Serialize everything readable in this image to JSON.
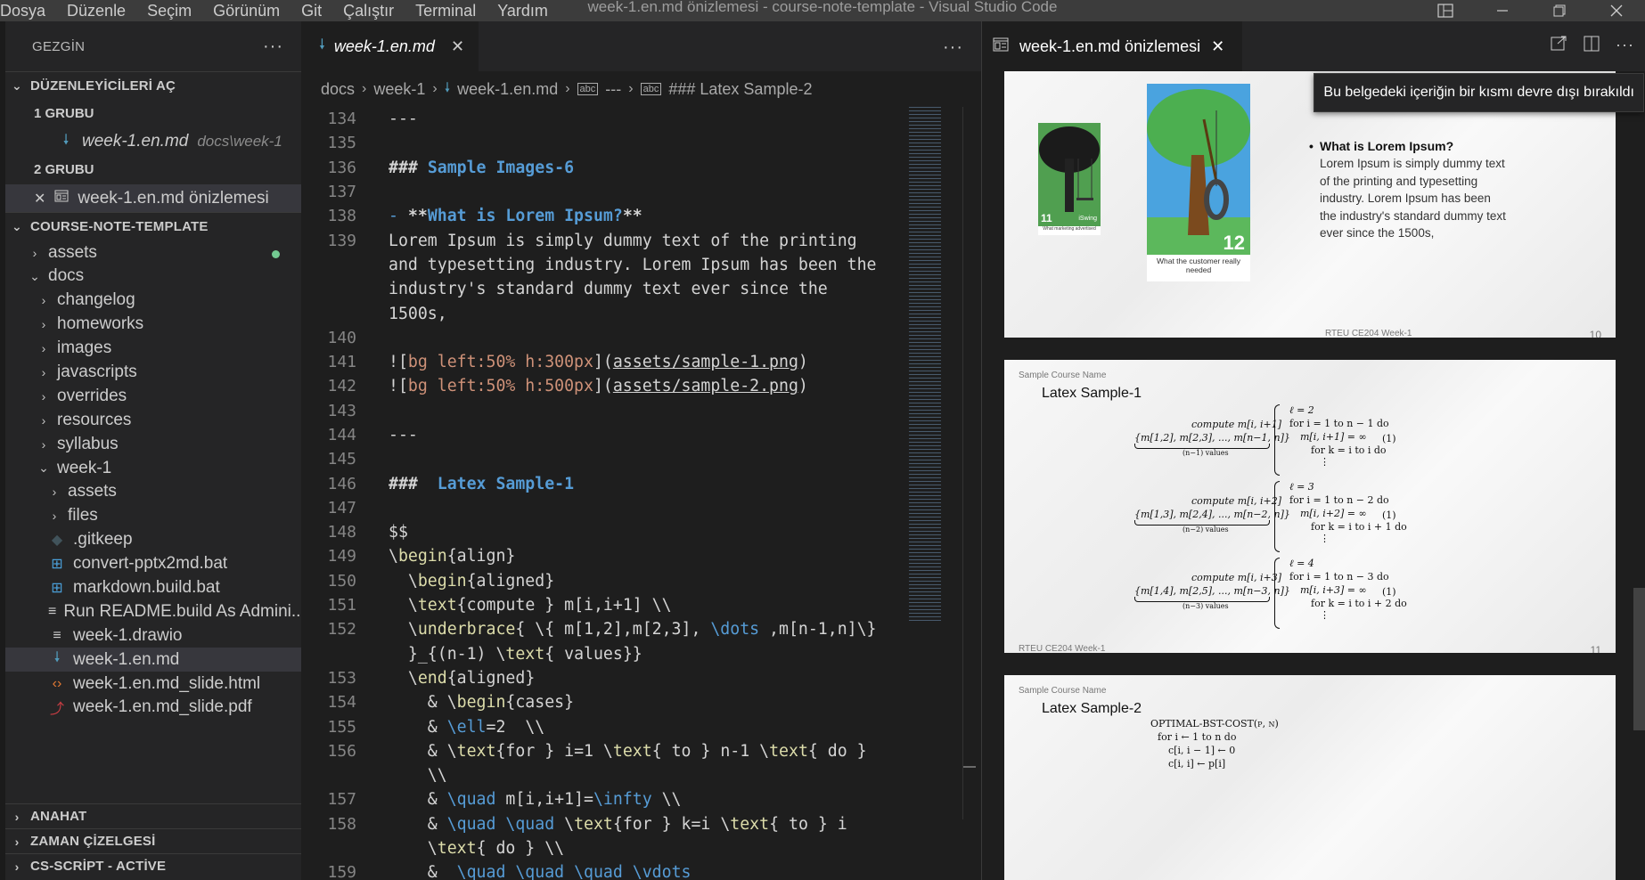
{
  "titlebar": {
    "menus": [
      "Dosya",
      "Düzenle",
      "Seçim",
      "Görünüm",
      "Git",
      "Çalıştır",
      "Terminal",
      "Yardım"
    ],
    "title": "week-1.en.md önizlemesi - course-note-template - Visual Studio Code"
  },
  "sidebar": {
    "title": "GEZGİN",
    "open_editors": {
      "label": "DÜZENLEYİCİLERİ AÇ",
      "group1": "1 GRUBU",
      "group1_file": "week-1.en.md",
      "group1_desc": "docs\\week-1",
      "group2": "2 GRUBU",
      "group2_file": "week-1.en.md önizlemesi"
    },
    "project": "COURSE-NOTE-TEMPLATE",
    "tree": [
      {
        "label": "assets",
        "indent": 1,
        "type": "folder",
        "open": false
      },
      {
        "label": "docs",
        "indent": 1,
        "type": "folder",
        "open": true
      },
      {
        "label": "changelog",
        "indent": 2,
        "type": "folder",
        "open": false
      },
      {
        "label": "homeworks",
        "indent": 2,
        "type": "folder",
        "open": false
      },
      {
        "label": "images",
        "indent": 2,
        "type": "folder",
        "open": false
      },
      {
        "label": "javascripts",
        "indent": 2,
        "type": "folder",
        "open": false
      },
      {
        "label": "overrides",
        "indent": 2,
        "type": "folder",
        "open": false
      },
      {
        "label": "resources",
        "indent": 2,
        "type": "folder",
        "open": false
      },
      {
        "label": "syllabus",
        "indent": 2,
        "type": "folder",
        "open": false
      },
      {
        "label": "week-1",
        "indent": 2,
        "type": "folder",
        "open": true
      },
      {
        "label": "assets",
        "indent": 3,
        "type": "folder",
        "open": false
      },
      {
        "label": "files",
        "indent": 3,
        "type": "folder",
        "open": false
      },
      {
        "label": ".gitkeep",
        "indent": 3,
        "type": "file",
        "icon": "git"
      },
      {
        "label": "convert-pptx2md.bat",
        "indent": 3,
        "type": "file",
        "icon": "win"
      },
      {
        "label": "markdown.build.bat",
        "indent": 3,
        "type": "file",
        "icon": "win"
      },
      {
        "label": "Run README.build As Admini...",
        "indent": 3,
        "type": "file",
        "icon": "lines"
      },
      {
        "label": "week-1.drawio",
        "indent": 3,
        "type": "file",
        "icon": "lines"
      },
      {
        "label": "week-1.en.md",
        "indent": 3,
        "type": "file",
        "icon": "md"
      },
      {
        "label": "week-1.en.md_slide.html",
        "indent": 3,
        "type": "file",
        "icon": "html"
      },
      {
        "label": "week-1.en.md_slide.pdf",
        "indent": 3,
        "type": "file",
        "icon": "pdf"
      }
    ],
    "outline": "ANAHAT",
    "timeline": "ZAMAN ÇİZELGESİ",
    "cs_script": "CS-SCRİPT - ACTİVE"
  },
  "editor": {
    "tab_label": "week-1.en.md",
    "breadcrumb": [
      "docs",
      "week-1",
      "week-1.en.md",
      "---",
      "### Latex Sample-2"
    ],
    "lines": [
      {
        "n": "134",
        "t": "---"
      },
      {
        "n": "135",
        "t": ""
      },
      {
        "n": "136",
        "t": "### Sample Images-6"
      },
      {
        "n": "137",
        "t": ""
      },
      {
        "n": "138",
        "t": "- **What is Lorem Ipsum?**"
      },
      {
        "n": "139",
        "t": "Lorem Ipsum is simply dummy text of the printing"
      },
      {
        "n": "",
        "t": "and typesetting industry. Lorem Ipsum has been the"
      },
      {
        "n": "",
        "t": "industry's standard dummy text ever since the"
      },
      {
        "n": "",
        "t": "1500s,"
      },
      {
        "n": "140",
        "t": ""
      },
      {
        "n": "141",
        "t": "![bg left:50% h:300px](assets/sample-1.png)"
      },
      {
        "n": "142",
        "t": "![bg left:50% h:500px](assets/sample-2.png)"
      },
      {
        "n": "143",
        "t": ""
      },
      {
        "n": "144",
        "t": "---"
      },
      {
        "n": "145",
        "t": ""
      },
      {
        "n": "146",
        "t": "###  Latex Sample-1"
      },
      {
        "n": "147",
        "t": ""
      },
      {
        "n": "148",
        "t": "$$"
      },
      {
        "n": "149",
        "t": "\\begin{align}"
      },
      {
        "n": "150",
        "t": "  \\begin{aligned}"
      },
      {
        "n": "151",
        "t": "  \\text{compute } m[i,i+1] \\\\"
      },
      {
        "n": "152",
        "t": "  \\underbrace{ \\{ m[1,2],m[2,3], \\dots ,m[n-1,n]\\}"
      },
      {
        "n": "",
        "t": "  }_{(n-1) \\text{ values}}"
      },
      {
        "n": "153",
        "t": "  \\end{aligned}"
      },
      {
        "n": "154",
        "t": "    & \\begin{cases}"
      },
      {
        "n": "155",
        "t": "    & \\ell=2  \\\\"
      },
      {
        "n": "156",
        "t": "    & \\text{for } i=1 \\text{ to } n-1 \\text{ do }"
      },
      {
        "n": "",
        "t": "    \\\\"
      },
      {
        "n": "157",
        "t": "    & \\quad m[i,i+1]=\\infty \\\\"
      },
      {
        "n": "158",
        "t": "    & \\quad \\quad \\text{for } k=i \\text{ to } i"
      },
      {
        "n": "",
        "t": "    \\text{ do } \\\\"
      },
      {
        "n": "159",
        "t": "    &  \\quad \\quad \\quad \\vdots"
      }
    ]
  },
  "preview": {
    "tab_label": "week-1.en.md önizlemesi",
    "banner": "Bu belgedeki içeriğin bir kısmı devre dışı bırakıldı",
    "slide10": {
      "img1_num": "11",
      "img1_tag": "iSwing",
      "img1_caption": "What marketing advertised",
      "img2_num": "12",
      "img2_caption": "What the customer really needed",
      "bullet_title": "What is Lorem Ipsum?",
      "bullet_text": "Lorem Ipsum is simply dummy text of the printing and typesetting industry. Lorem Ipsum has been the industry's standard dummy text ever since the 1500s,",
      "footer": "RTEU CE204 Week-1",
      "page": "10"
    },
    "slide11": {
      "course": "Sample Course Name",
      "title": "Latex Sample-1",
      "blocks": [
        {
          "compute": "compute m[i, i+1]",
          "set": "{m[1,2], m[2,3], ..., m[n−1, n]}",
          "values": "(n−1) values",
          "ell": "ℓ = 2",
          "for": "for i = 1 to n − 1 do",
          "inf": "m[i, i+1] = ∞",
          "fork": "for k = i to i do",
          "eq": "(1)"
        },
        {
          "compute": "compute m[i, i+2]",
          "set": "{m[1,3], m[2,4], ..., m[n−2, n]}",
          "values": "(n−2) values",
          "ell": "ℓ = 3",
          "for": "for i = 1 to n − 2 do",
          "inf": "m[i, i+2] = ∞",
          "fork": "for k = i to i + 1 do",
          "eq": "(1)"
        },
        {
          "compute": "compute m[i, i+3]",
          "set": "{m[1,4], m[2,5], ..., m[n−3, n]}",
          "values": "(n−3) values",
          "ell": "ℓ = 4",
          "for": "for i = 1 to n − 3 do",
          "inf": "m[i, i+3] = ∞",
          "fork": "for k = i to i + 2 do",
          "eq": "(1)"
        }
      ],
      "footer": "RTEU CE204 Week-1",
      "page": "11"
    },
    "slide12": {
      "course": "Sample Course Name",
      "title": "Latex Sample-2",
      "algo": [
        "OPTIMAL-BST-COST(p, n)",
        "for i ← 1 to n do",
        "c[i, i − 1] ← 0",
        "c[i, i] ← p[i]"
      ]
    }
  },
  "colors": {
    "heading": "#569cd6",
    "string": "#ce9178",
    "accent_md": "#519aba",
    "git_added": "#73c991"
  }
}
